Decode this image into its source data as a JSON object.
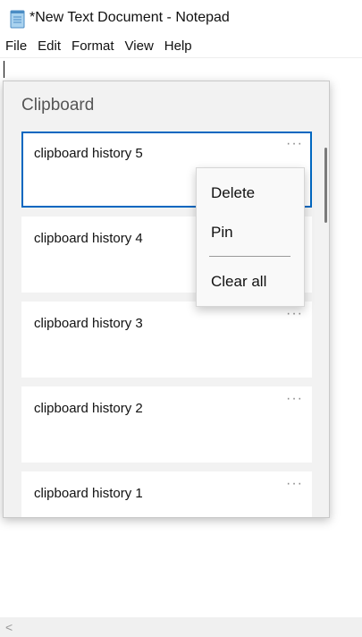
{
  "window": {
    "title": "*New Text Document - Notepad"
  },
  "menubar": {
    "items": [
      "File",
      "Edit",
      "Format",
      "View",
      "Help"
    ]
  },
  "clipboard": {
    "title": "Clipboard",
    "items": [
      {
        "text": "clipboard history 5",
        "more": "···"
      },
      {
        "text": "clipboard history 4",
        "more": "···"
      },
      {
        "text": "clipboard history 3",
        "more": "···"
      },
      {
        "text": "clipboard history 2",
        "more": "···"
      },
      {
        "text": "clipboard history 1",
        "more": "···"
      }
    ]
  },
  "context_menu": {
    "delete": "Delete",
    "pin": "Pin",
    "clear_all": "Clear all"
  },
  "scrollbar": {
    "left_arrow": "<"
  },
  "colors": {
    "accent": "#0067c0",
    "panel_bg": "#f2f2f2"
  }
}
